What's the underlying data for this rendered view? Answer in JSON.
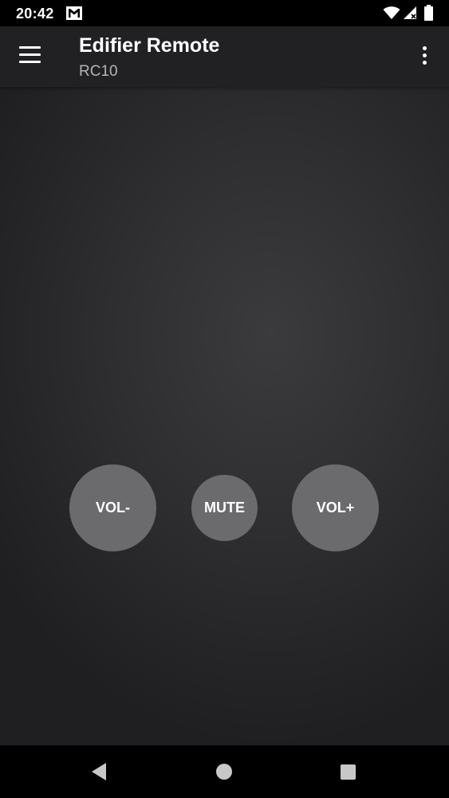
{
  "status_bar": {
    "time": "20:42",
    "icons": [
      "gmail-icon",
      "wifi-icon",
      "signal-icon",
      "battery-icon"
    ]
  },
  "app_bar": {
    "title": "Edifier Remote",
    "subtitle": "RC10",
    "menu_icon": "menu-icon",
    "overflow_icon": "more-vert-icon"
  },
  "remote": {
    "vol_down_label": "VOL-",
    "mute_label": "MUTE",
    "vol_up_label": "VOL+"
  },
  "nav_bar": {
    "icons": [
      "back-icon",
      "home-icon",
      "recents-icon"
    ]
  },
  "colors": {
    "background": "#2f2e31",
    "app_bar": "#212022",
    "button": "#6b6a6d",
    "text": "#ffffff",
    "subtitle": "#b4b3b6"
  }
}
